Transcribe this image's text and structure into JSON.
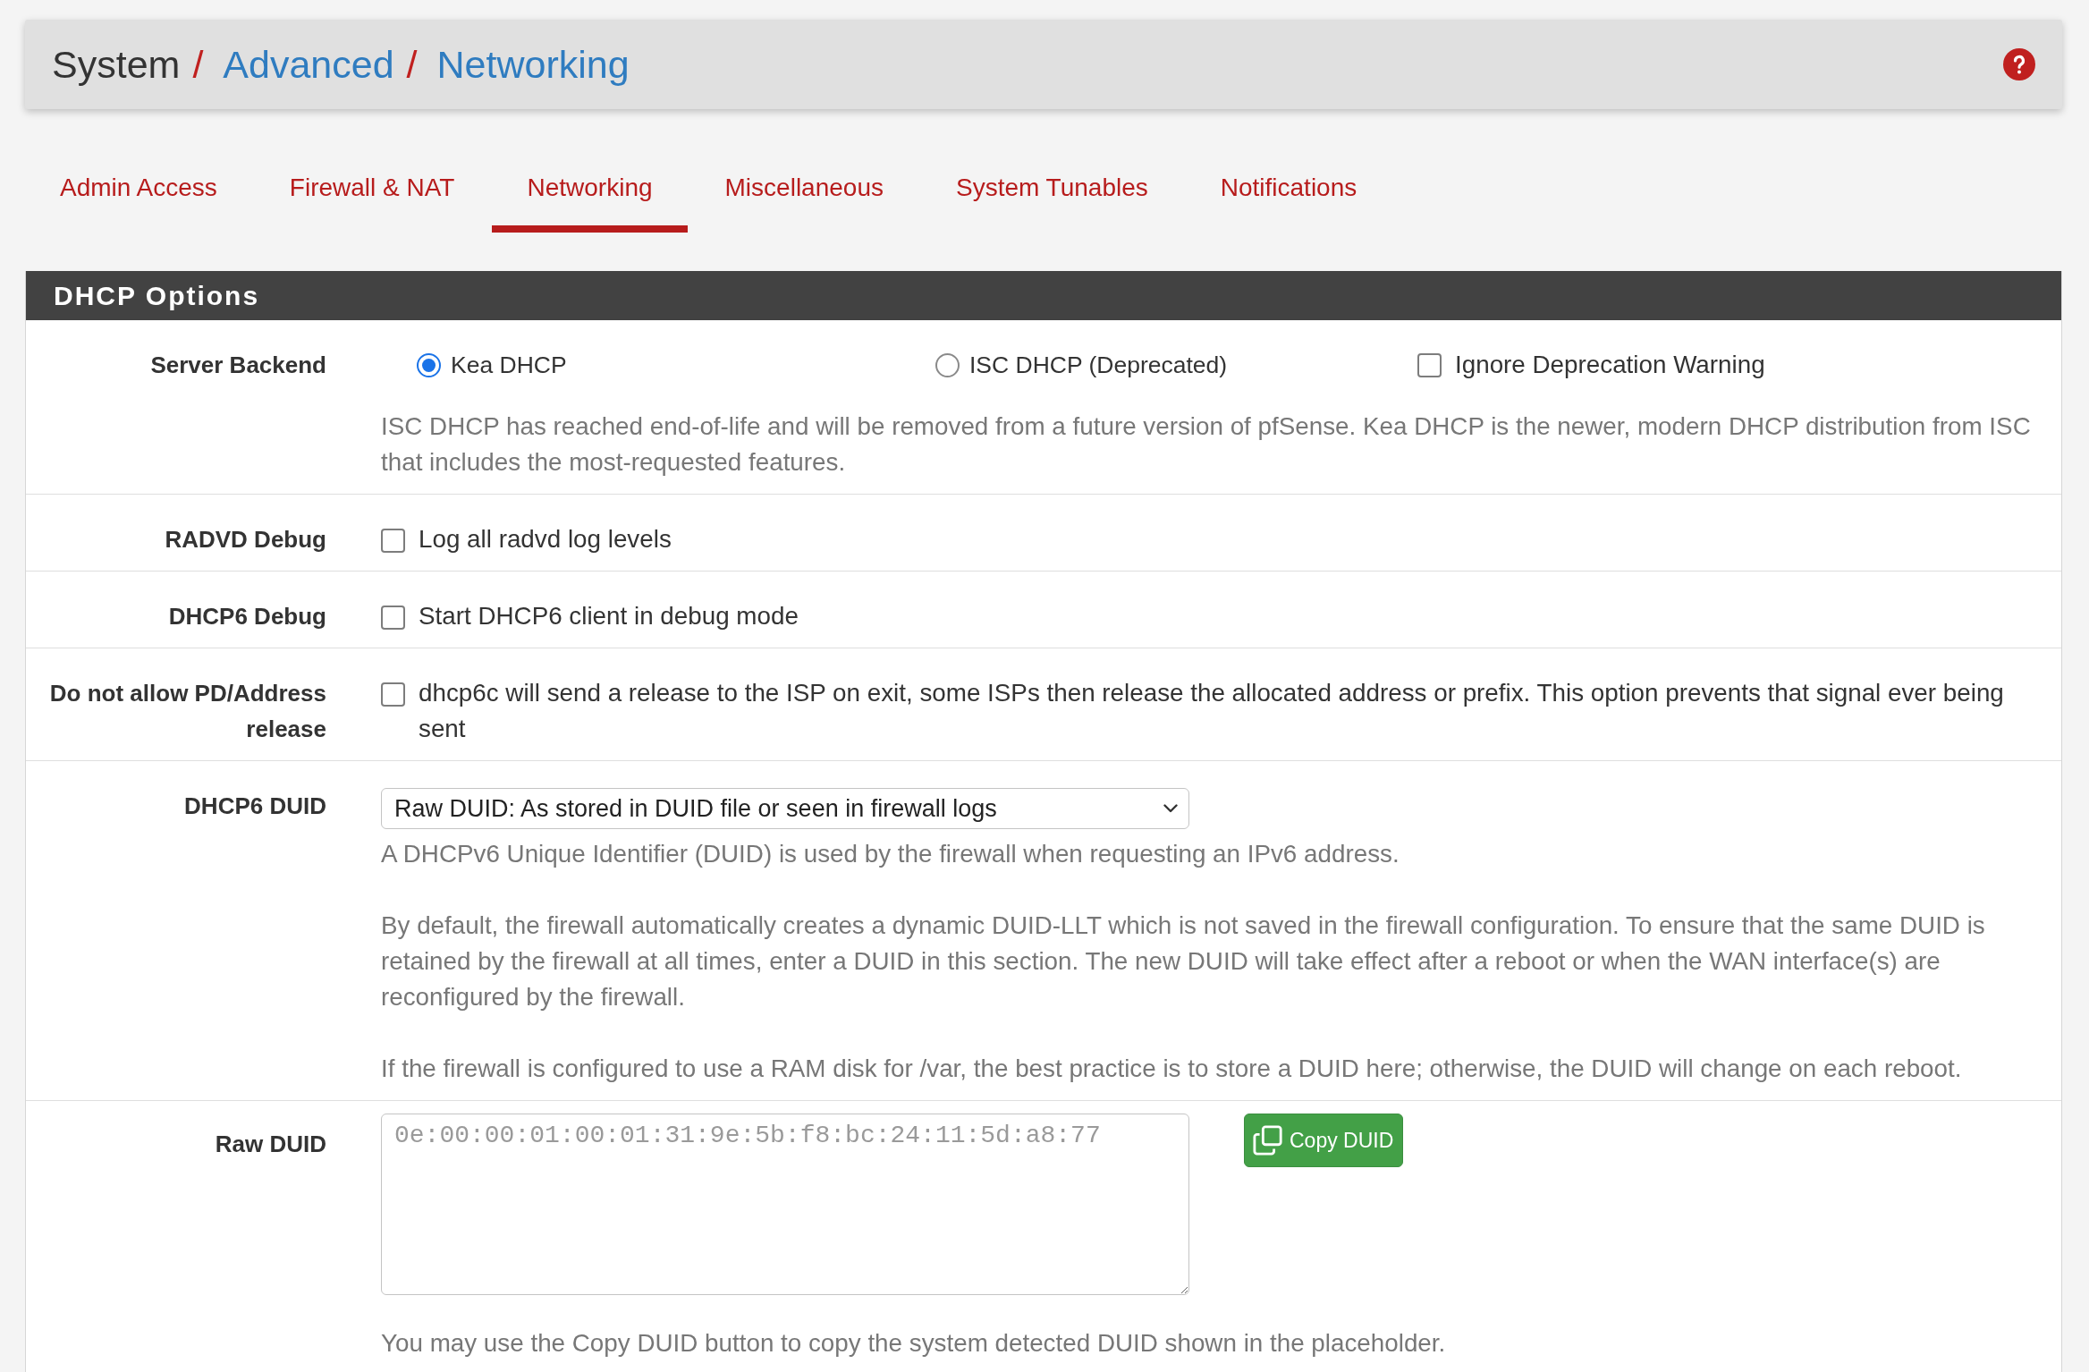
{
  "breadcrumb": [
    {
      "kind": "plain",
      "text": "System"
    },
    {
      "kind": "separator",
      "text": "/"
    },
    {
      "kind": "link",
      "text": "Advanced"
    },
    {
      "kind": "separator",
      "text": "/"
    },
    {
      "kind": "link",
      "text": "Networking"
    }
  ],
  "tabs": [
    {
      "label": "Admin Access",
      "selected": false
    },
    {
      "label": "Firewall & NAT",
      "selected": false
    },
    {
      "label": "Networking",
      "selected": true
    },
    {
      "label": "Miscellaneous",
      "selected": false
    },
    {
      "label": "System Tunables",
      "selected": false
    },
    {
      "label": "Notifications",
      "selected": false
    }
  ],
  "panel": {
    "title": "DHCP Options",
    "rows": [
      {
        "kind": "choices",
        "label": "Server Backend",
        "options": [
          {
            "kind": "radio",
            "text": "Kea DHCP",
            "selected": true
          },
          {
            "kind": "radio",
            "text": "ISC DHCP (Deprecated)",
            "selected": false
          },
          {
            "kind": "checkbox",
            "text": "Ignore Deprecation Warning",
            "checked": false
          }
        ],
        "help": [
          "ISC DHCP has reached end-of-life and will be removed from a future version of pfSense. Kea DHCP is the newer, modern DHCP distribution from ISC that includes the most-requested features."
        ]
      },
      {
        "kind": "checkbox",
        "label": "RADVD Debug",
        "text": "Log all radvd log levels",
        "checked": false
      },
      {
        "kind": "checkbox",
        "label": "DHCP6 Debug",
        "text": "Start DHCP6 client in debug mode",
        "checked": false
      },
      {
        "kind": "checkbox",
        "label": "Do not allow PD/Address release",
        "text": "dhcp6c will send a release to the ISP on exit, some ISPs then release the allocated address or prefix. This option prevents that signal ever being sent",
        "checked": false
      },
      {
        "kind": "select",
        "label": "DHCP6 DUID",
        "value": "Raw DUID: As stored in DUID file or seen in firewall logs",
        "help": [
          "A DHCPv6 Unique Identifier (DUID) is used by the firewall when requesting an IPv6 address.",
          "By default, the firewall automatically creates a dynamic DUID-LLT which is not saved in the firewall configuration. To ensure that the same DUID is retained by the firewall at all times, enter a DUID in this section. The new DUID will take effect after a reboot or when the WAN interface(s) are reconfigured by the firewall.",
          "If the firewall is configured to use a RAM disk for /var, the best practice is to store a DUID here; otherwise, the DUID will change on each reboot."
        ]
      },
      {
        "kind": "textarea",
        "label": "Raw DUID",
        "placeholder": "0e:00:00:01:00:01:31:9e:5b:f8:bc:24:11:5d:a8:77",
        "button": "Copy DUID",
        "help": [
          "You may use the Copy DUID button to copy the system detected DUID shown in the placeholder."
        ]
      }
    ]
  }
}
